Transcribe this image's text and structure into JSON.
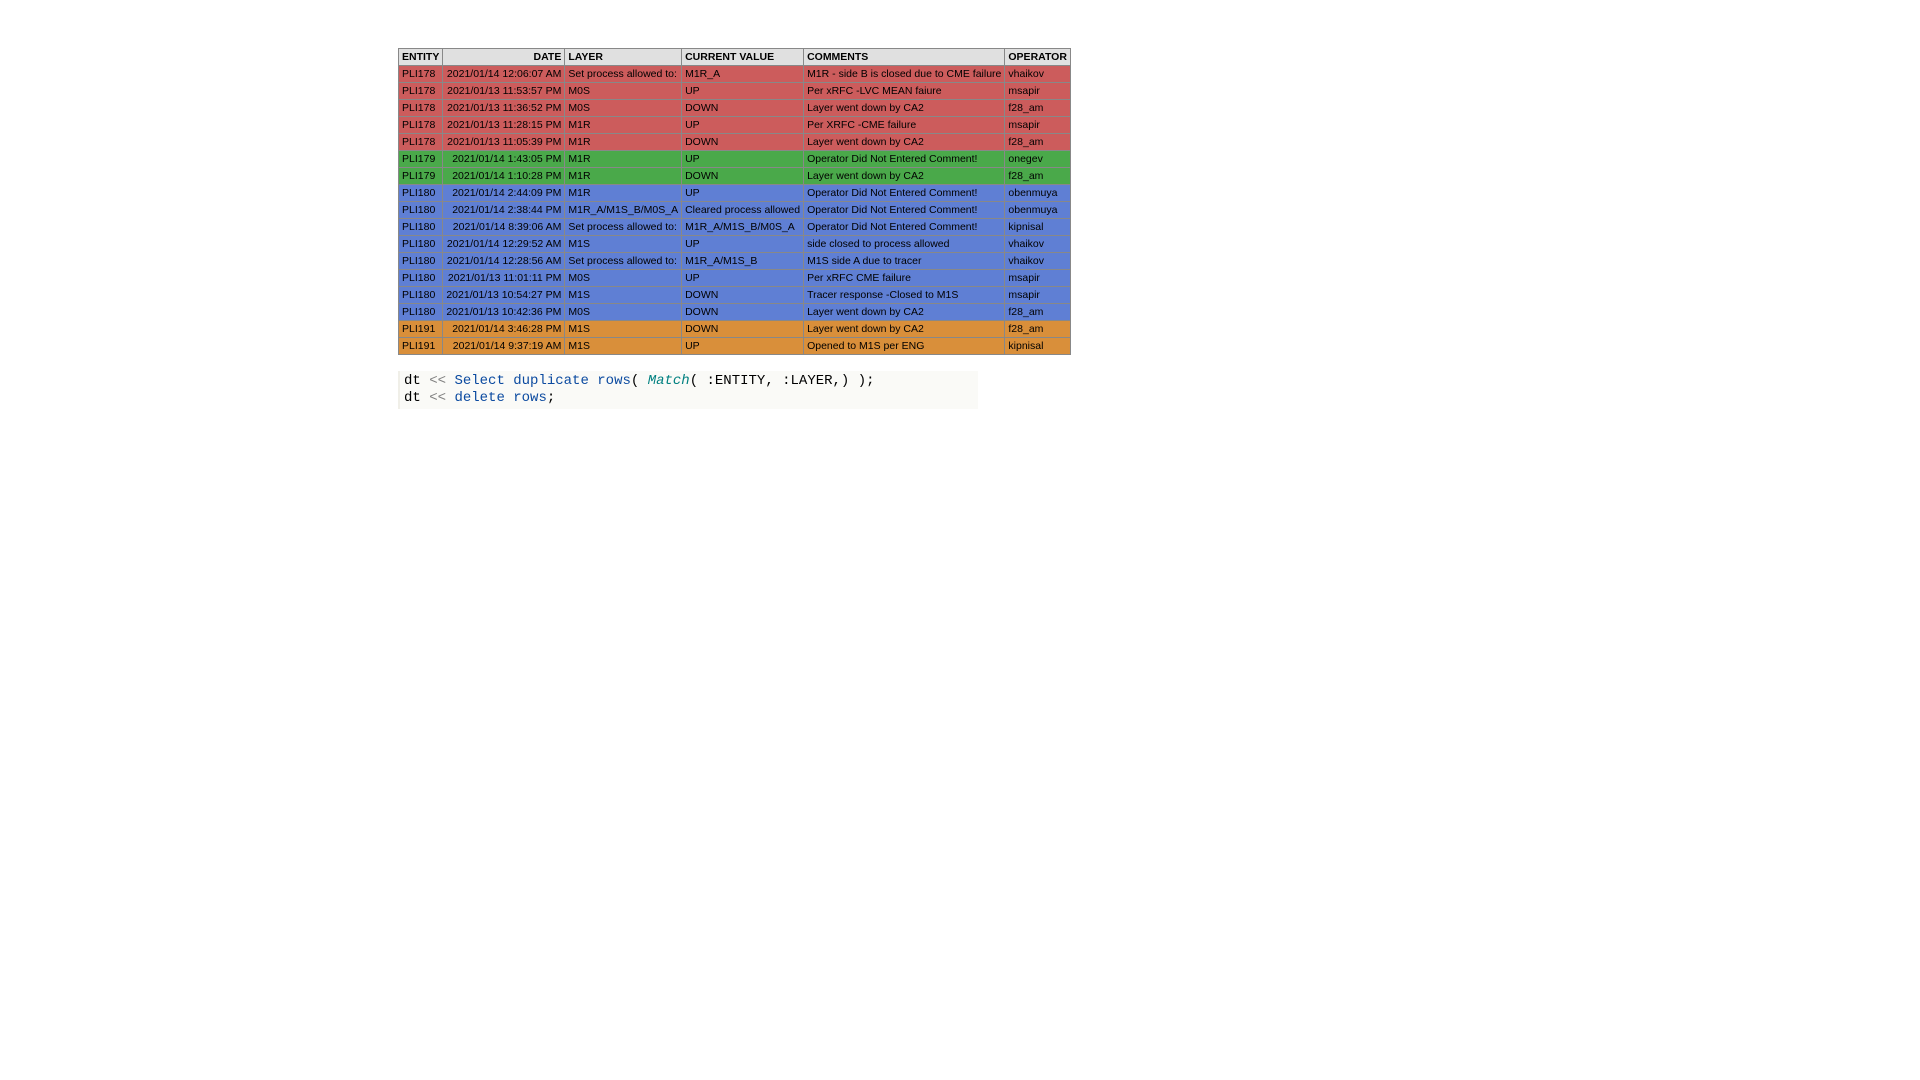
{
  "columns": [
    "ENTITY",
    "DATE",
    "LAYER",
    "CURRENT VALUE",
    "COMMENTS",
    "OPERATOR"
  ],
  "rows": [
    {
      "entity": "PLI178",
      "date": "2021/01/14 12:06:07 AM",
      "layer": "Set process allowed to:",
      "cur": "M1R_A",
      "comments": "M1R - side B is closed due to CME failure",
      "op": "vhaikov",
      "color": "red"
    },
    {
      "entity": "PLI178",
      "date": "2021/01/13 11:53:57 PM",
      "layer": "M0S",
      "cur": "UP",
      "comments": "Per xRFC -LVC MEAN faiure",
      "op": "msapir",
      "color": "red"
    },
    {
      "entity": "PLI178",
      "date": "2021/01/13 11:36:52 PM",
      "layer": "M0S",
      "cur": "DOWN",
      "comments": "Layer went down by CA2",
      "op": "f28_am",
      "color": "red"
    },
    {
      "entity": "PLI178",
      "date": "2021/01/13 11:28:15 PM",
      "layer": "M1R",
      "cur": "UP",
      "comments": "Per XRFC -CME failure",
      "op": "msapir",
      "color": "red"
    },
    {
      "entity": "PLI178",
      "date": "2021/01/13 11:05:39 PM",
      "layer": "M1R",
      "cur": "DOWN",
      "comments": "Layer went down by CA2",
      "op": "f28_am",
      "color": "red"
    },
    {
      "entity": "PLI179",
      "date": "2021/01/14 1:43:05 PM",
      "layer": "M1R",
      "cur": "UP",
      "comments": "Operator Did Not Entered Comment!",
      "op": "onegev",
      "color": "green"
    },
    {
      "entity": "PLI179",
      "date": "2021/01/14 1:10:28 PM",
      "layer": "M1R",
      "cur": "DOWN",
      "comments": "Layer went down by CA2",
      "op": "f28_am",
      "color": "green"
    },
    {
      "entity": "PLI180",
      "date": "2021/01/14 2:44:09 PM",
      "layer": "M1R",
      "cur": "UP",
      "comments": "Operator Did Not Entered Comment!",
      "op": "obenmuya",
      "color": "blue"
    },
    {
      "entity": "PLI180",
      "date": "2021/01/14 2:38:44 PM",
      "layer": "M1R_A/M1S_B/M0S_A",
      "cur": "Cleared process allowed",
      "comments": "Operator Did Not Entered Comment!",
      "op": "obenmuya",
      "color": "blue"
    },
    {
      "entity": "PLI180",
      "date": "2021/01/14 8:39:06 AM",
      "layer": "Set process allowed to:",
      "cur": "M1R_A/M1S_B/M0S_A",
      "comments": "Operator Did Not Entered Comment!",
      "op": "kipnisal",
      "color": "blue"
    },
    {
      "entity": "PLI180",
      "date": "2021/01/14 12:29:52 AM",
      "layer": "M1S",
      "cur": "UP",
      "comments": "side closed to process allowed",
      "op": "vhaikov",
      "color": "blue"
    },
    {
      "entity": "PLI180",
      "date": "2021/01/14 12:28:56 AM",
      "layer": "Set process allowed to:",
      "cur": "M1R_A/M1S_B",
      "comments": "M1S side A due to tracer",
      "op": "vhaikov",
      "color": "blue"
    },
    {
      "entity": "PLI180",
      "date": "2021/01/13 11:01:11 PM",
      "layer": "M0S",
      "cur": "UP",
      "comments": "Per xRFC CME failure",
      "op": "msapir",
      "color": "blue"
    },
    {
      "entity": "PLI180",
      "date": "2021/01/13 10:54:27 PM",
      "layer": "M1S",
      "cur": "DOWN",
      "comments": "Tracer response -Closed to M1S",
      "op": "msapir",
      "color": "blue"
    },
    {
      "entity": "PLI180",
      "date": "2021/01/13 10:42:36 PM",
      "layer": "M0S",
      "cur": "DOWN",
      "comments": "Layer went down by CA2",
      "op": "f28_am",
      "color": "blue"
    },
    {
      "entity": "PLI191",
      "date": "2021/01/14 3:46:28 PM",
      "layer": "M1S",
      "cur": "DOWN",
      "comments": "Layer went down by CA2",
      "op": "f28_am",
      "color": "orange"
    },
    {
      "entity": "PLI191",
      "date": "2021/01/14 9:37:19 AM",
      "layer": "M1S",
      "cur": "UP",
      "comments": "Opened to M1S per ENG",
      "op": "kipnisal",
      "color": "orange"
    }
  ],
  "code": {
    "dt": "dt",
    "op": "<<",
    "select": "Select duplicate rows",
    "match": "Match",
    "args": "( :ENTITY, :LAYER,) );",
    "delete": "delete rows",
    "semi": ";"
  }
}
